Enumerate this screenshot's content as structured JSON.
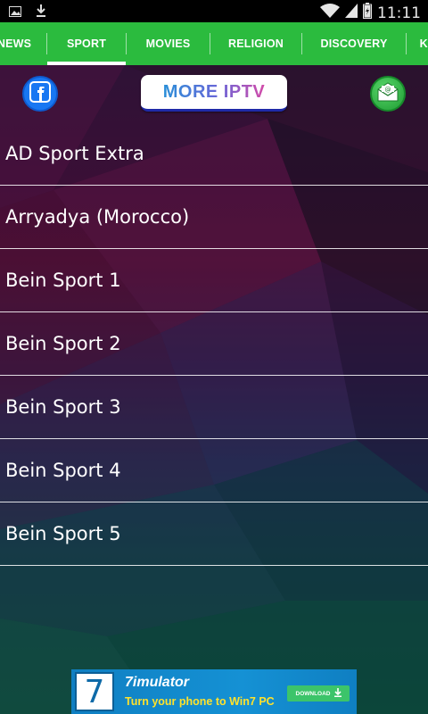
{
  "status_bar": {
    "time": "11:11",
    "icons": [
      "image-icon",
      "download-icon",
      "wifi-icon",
      "signal-icon",
      "battery-icon"
    ]
  },
  "tabs": [
    {
      "label": "NEWS",
      "active": false
    },
    {
      "label": "SPORT",
      "active": true
    },
    {
      "label": "MOVIES",
      "active": false
    },
    {
      "label": "RELIGION",
      "active": false
    },
    {
      "label": "DISCOVERY",
      "active": false
    },
    {
      "label": "KIDS",
      "active": false
    }
  ],
  "actions": {
    "facebook_icon": "facebook-icon",
    "more_iptv_label": "MORE IPTV",
    "email_icon": "email-icon"
  },
  "channels": [
    {
      "name": "AD Sport Extra"
    },
    {
      "name": "Arryadya (Morocco)"
    },
    {
      "name": "Bein Sport 1"
    },
    {
      "name": "Bein Sport 2"
    },
    {
      "name": "Bein Sport 3"
    },
    {
      "name": "Bein Sport 4"
    },
    {
      "name": "Bein Sport 5"
    }
  ],
  "ad": {
    "logo_text": "7",
    "title": "7imulator",
    "subtitle": "Turn your phone to Win7 PC",
    "download_label": "DOWNLOAD"
  },
  "colors": {
    "tab_bar": "#2bbb3e",
    "facebook": "#1877f2",
    "email_button": "#2fae42",
    "ad_background": "#1591d4"
  }
}
